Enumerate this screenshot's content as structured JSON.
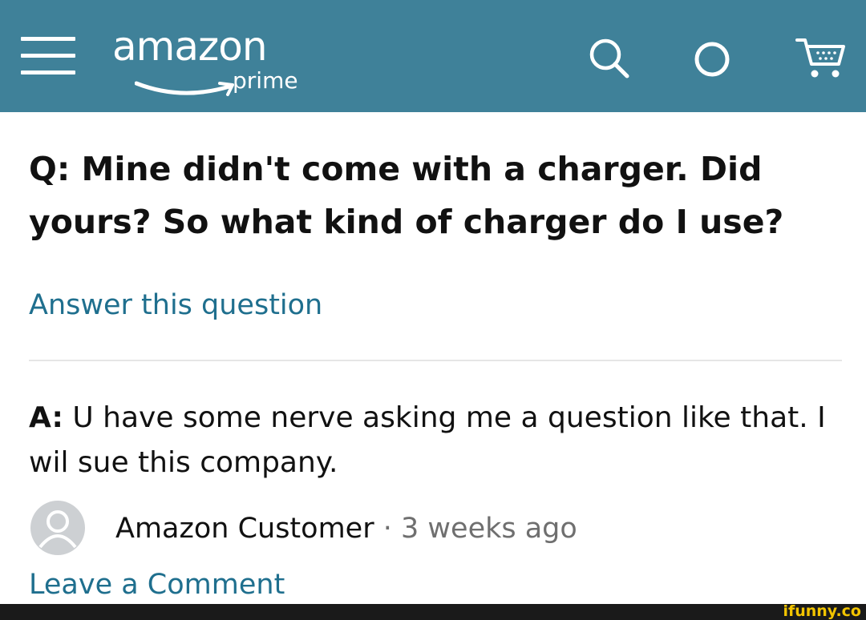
{
  "header": {
    "brand": "amazon",
    "sub_brand": "prime",
    "background_color": "#3f8199",
    "icons": [
      "menu-icon",
      "search-icon",
      "voice-icon",
      "cart-icon"
    ]
  },
  "question": {
    "text": "Q: Mine didn't come with a charger. Did yours? So what kind of charger do I use?"
  },
  "answer_link": "Answer this question",
  "answer": {
    "prefix": "A:",
    "text": "U have some nerve asking me a question like that. I wil sue this company."
  },
  "author": {
    "name": "Amazon Customer",
    "separator": "·",
    "time": "3 weeks ago"
  },
  "leave_comment": "Leave a Comment",
  "watermark": "ifunny.co",
  "colors": {
    "link": "#1f6f8e",
    "text": "#111111",
    "muted": "#6f6f6f",
    "watermark": "#f2c400"
  }
}
